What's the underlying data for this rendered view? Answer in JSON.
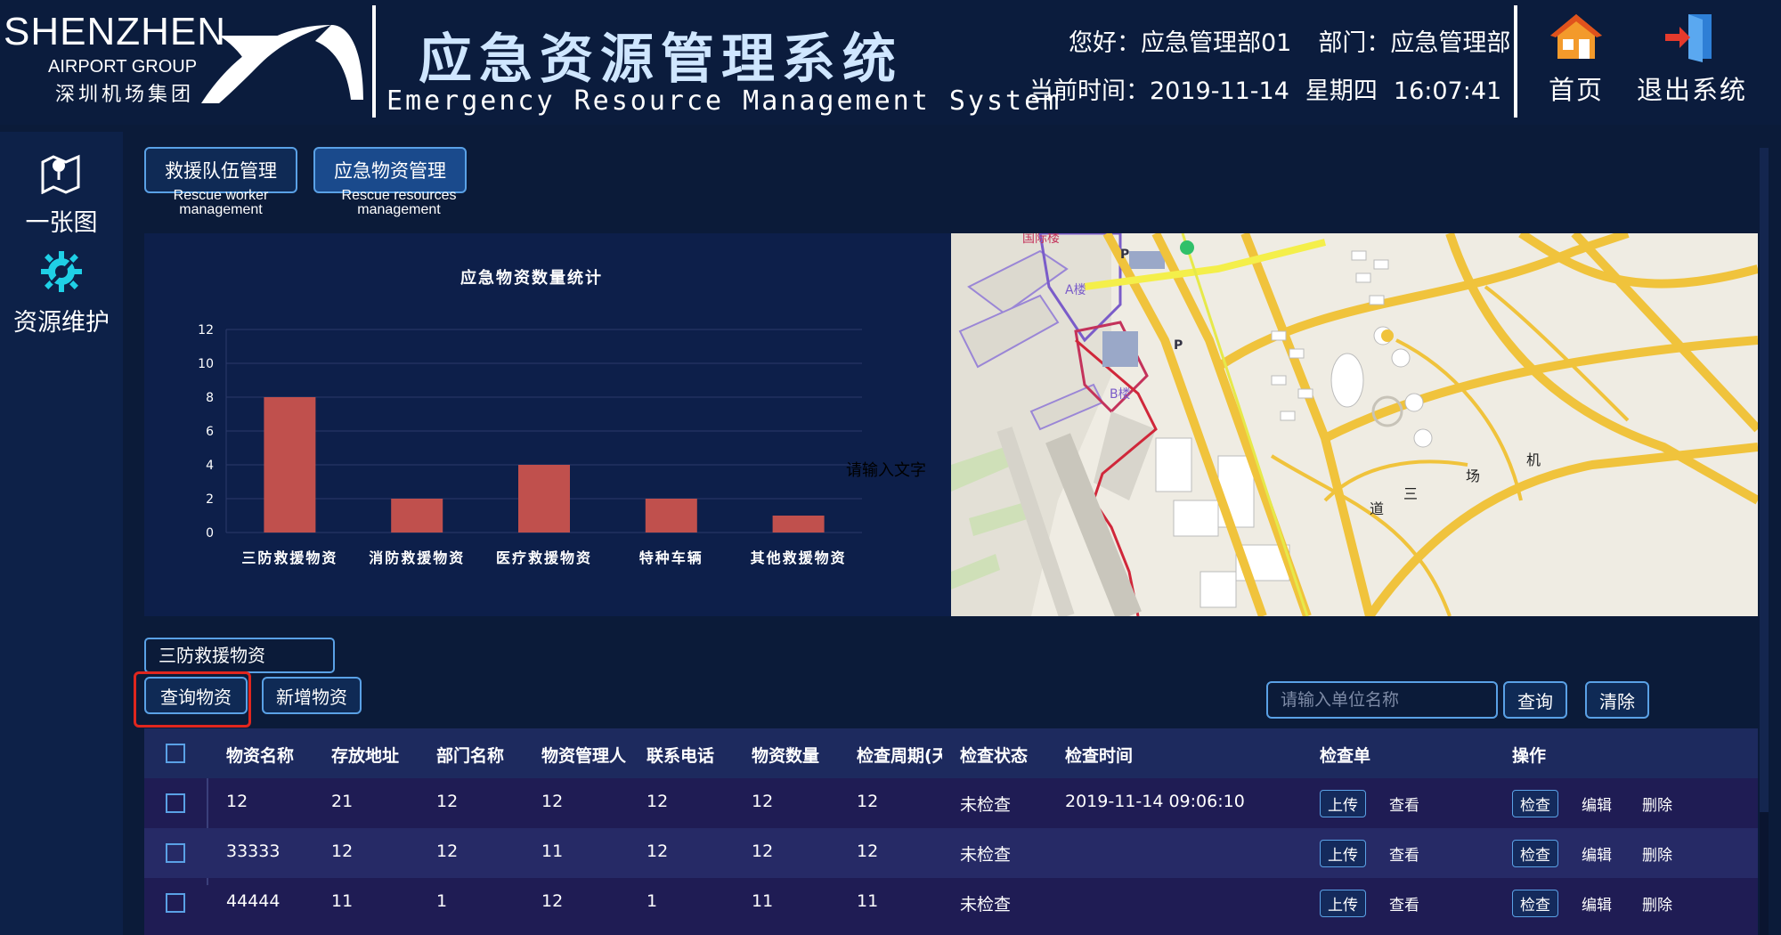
{
  "header": {
    "logo_main": "SHENZHEN",
    "logo_sub1": "AIRPORT GROUP",
    "logo_sub2": "深圳机场集团",
    "title": "应急资源管理系统",
    "subtitle": "Emergency Resource Management System",
    "greeting": "您好：应急管理部01",
    "department": "部门：应急管理部",
    "time_label": "当前时间：",
    "date": "2019-11-14",
    "weekday": "星期四",
    "time": "16:07:41",
    "home_label": "首页",
    "exit_label": "退出系统"
  },
  "sidebar": {
    "items": [
      {
        "label": "一张图",
        "icon": "map-icon"
      },
      {
        "label": "资源维护",
        "icon": "gear-icon"
      }
    ]
  },
  "tabs": [
    {
      "label": "救援队伍管理",
      "sub1": "Rescue worker",
      "sub2": "management"
    },
    {
      "label": "应急物资管理",
      "sub1": "Rescue resources",
      "sub2": "management"
    }
  ],
  "chart_data": {
    "type": "bar",
    "title": "应急物资数量统计",
    "categories": [
      "三防救援物资",
      "消防救援物资",
      "医疗救援物资",
      "特种车辆",
      "其他救援物资"
    ],
    "values": [
      8,
      2,
      4,
      2,
      1
    ],
    "ylim": [
      0,
      12
    ],
    "yticks": [
      0,
      2,
      4,
      6,
      8,
      10,
      12
    ],
    "bar_color": "#c0504d",
    "grid": true
  },
  "map": {
    "placeholder": "请输入文字",
    "labels": [
      "国际楼",
      "A楼",
      "B楼",
      "道",
      "三",
      "场",
      "机"
    ]
  },
  "controls": {
    "category": "三防救援物资",
    "query_button": "查询物资",
    "add_button": "新增物资",
    "search_placeholder": "请输入单位名称",
    "search_button": "查询",
    "clear_button": "清除"
  },
  "table": {
    "headers": [
      "物资名称",
      "存放地址",
      "部门名称",
      "物资管理人",
      "联系电话",
      "物资数量",
      "检查周期(天",
      "检查状态",
      "检查时间",
      "检查单",
      "操作"
    ],
    "rows": [
      [
        "12",
        "21",
        "12",
        "12",
        "12",
        "12",
        "12",
        "未检查",
        "2019-11-14 09:06:10"
      ],
      [
        "33333",
        "12",
        "12",
        "11",
        "12",
        "12",
        "12",
        "未检查",
        ""
      ],
      [
        "44444",
        "11",
        "1",
        "12",
        "1",
        "11",
        "11",
        "未检查",
        ""
      ]
    ],
    "actions": {
      "upload": "上传",
      "view": "查看",
      "check": "检查",
      "edit": "编辑",
      "delete": "删除"
    }
  },
  "colors": {
    "accent": "#5aa1e6",
    "highlight": "#e0261e",
    "bar": "#c0504d"
  }
}
